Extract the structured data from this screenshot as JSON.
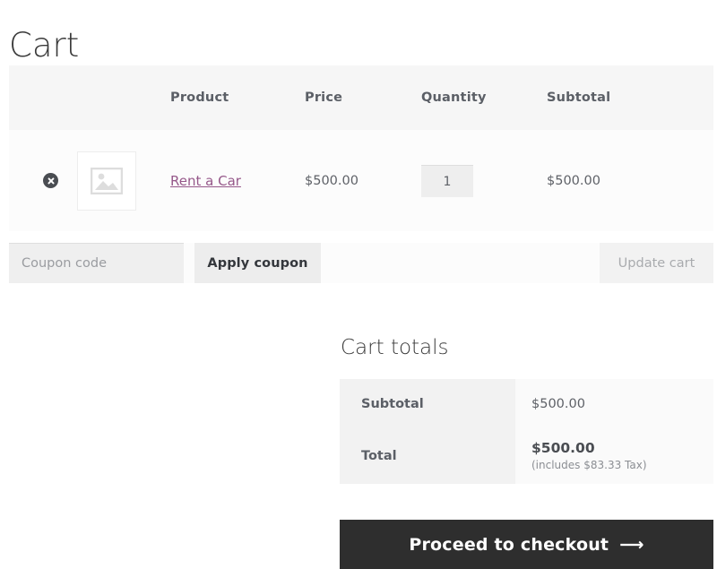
{
  "page": {
    "title": "Cart"
  },
  "cart_table": {
    "headers": {
      "remove": "",
      "thumbnail": "",
      "product": "Product",
      "price": "Price",
      "quantity": "Quantity",
      "subtotal": "Subtotal"
    },
    "items": [
      {
        "remove_icon": "remove-circle-icon",
        "thumbnail_icon": "image-placeholder-icon",
        "name": "Rent a Car",
        "price": "$500.00",
        "quantity": "1",
        "subtotal": "$500.00"
      }
    ]
  },
  "actions": {
    "coupon_placeholder": "Coupon code",
    "coupon_value": "",
    "apply_coupon_label": "Apply coupon",
    "update_cart_label": "Update cart"
  },
  "totals": {
    "title": "Cart totals",
    "subtotal_label": "Subtotal",
    "subtotal_value": "$500.00",
    "total_label": "Total",
    "total_value": "$500.00",
    "tax_note": "(includes $83.33 Tax)",
    "checkout_label": "Proceed to checkout",
    "checkout_arrow": "⟶"
  },
  "colors": {
    "link_purple": "#96588a",
    "checkout_bg": "#2e2e2e",
    "header_row_bg": "#f6f6f6",
    "item_row_bg": "#fcfcfc",
    "totals_label_bg": "#f2f2f2",
    "totals_value_bg": "#fafafa"
  }
}
